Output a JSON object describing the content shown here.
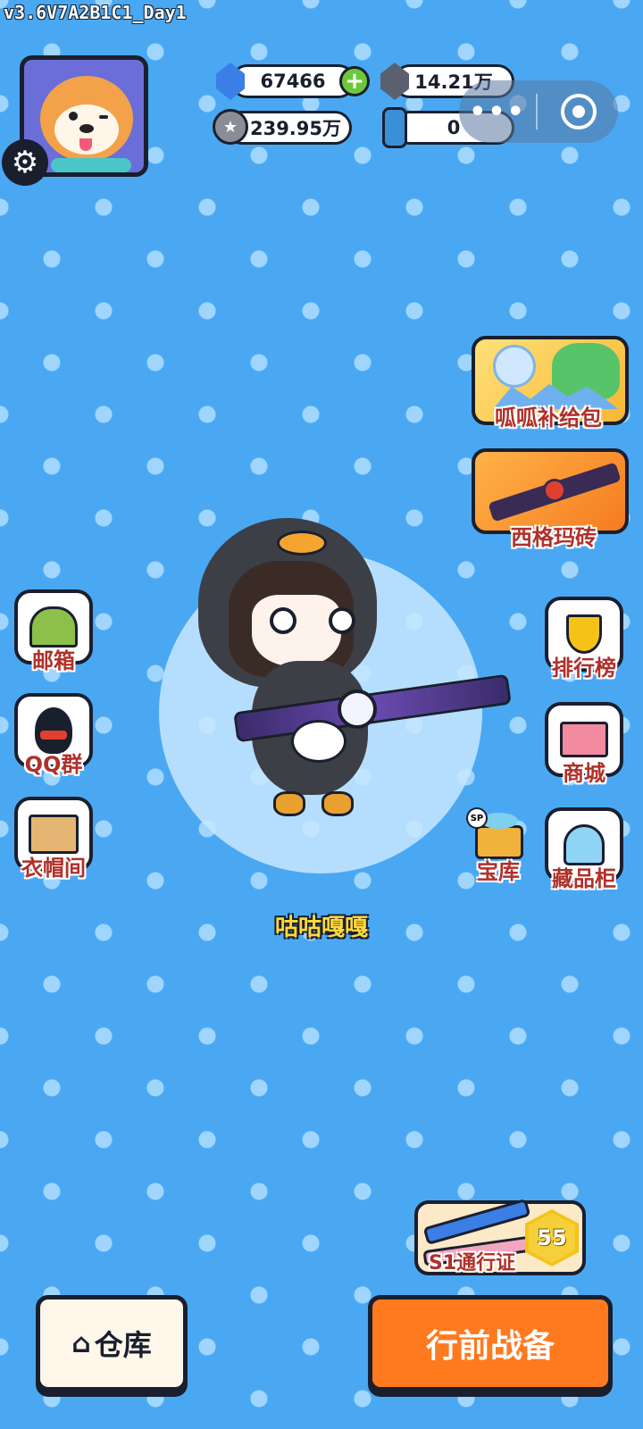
{
  "version": "v3.6V7A2B1C1_Day1",
  "resources": {
    "diamond": "67466",
    "crystal": "14.21万",
    "coin": "239.95万",
    "capsule": "0"
  },
  "char_name": "咕咕嘎嘎",
  "right_banners": {
    "supply_pack": "呱呱补给包",
    "sigma_brick": "西格玛砖"
  },
  "left_menu": {
    "mailbox": "邮箱",
    "qq_group": "QQ群",
    "wardrobe": "衣帽间"
  },
  "right_menu": {
    "leaderboard": "排行榜",
    "shop": "商城",
    "vault": "宝库",
    "vault_badge": "SP",
    "collection": "藏品柜"
  },
  "pass": {
    "label": "S1通行证",
    "level": "55"
  },
  "bottom": {
    "warehouse": "仓库",
    "battle": "行前战备"
  },
  "colors": {
    "background": "#4aa8f3",
    "battle_button": "#ff7a1f",
    "label_red": "#b0302a"
  },
  "icons": {
    "settings": "gear-icon",
    "more": "more-dots-icon",
    "close": "close-circle-icon",
    "home": "home-icon"
  }
}
